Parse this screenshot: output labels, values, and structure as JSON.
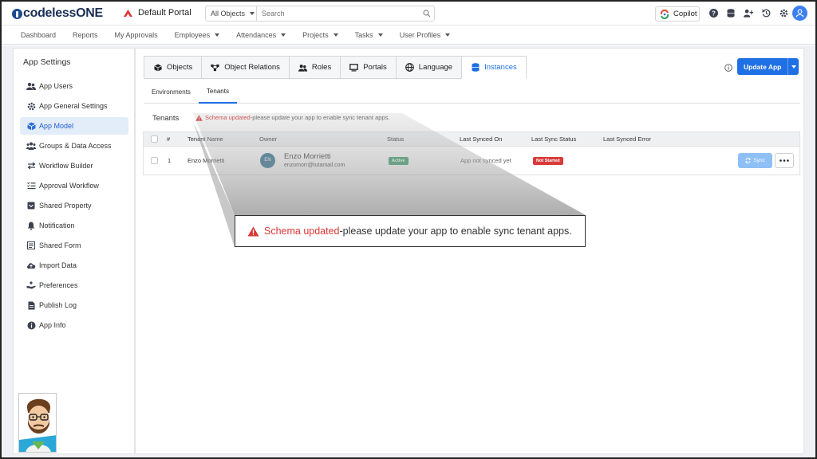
{
  "app": {
    "logo_text": "codelessONE",
    "portal": "Default Portal"
  },
  "search": {
    "scope": "All Objects",
    "placeholder": "Search"
  },
  "topbar": {
    "copilot": "Copilot"
  },
  "nav": [
    "Dashboard",
    "Reports",
    "My Approvals",
    "Employees",
    "Attendances",
    "Projects",
    "Tasks",
    "User Profiles"
  ],
  "sidebar": {
    "title": "App Settings",
    "items": [
      {
        "label": "App Users",
        "icon": "users-icon"
      },
      {
        "label": "App General Settings",
        "icon": "gear-icon"
      },
      {
        "label": "App Model",
        "icon": "cube-icon"
      },
      {
        "label": "Groups & Data Access",
        "icon": "group-icon"
      },
      {
        "label": "Workflow Builder",
        "icon": "arrows-icon"
      },
      {
        "label": "Approval Workflow",
        "icon": "checklist-icon"
      },
      {
        "label": "Shared Property",
        "icon": "shared-property-icon"
      },
      {
        "label": "Notification",
        "icon": "bell-icon"
      },
      {
        "label": "Shared Form",
        "icon": "form-icon"
      },
      {
        "label": "Import Data",
        "icon": "cloud-upload-icon"
      },
      {
        "label": "Preferences",
        "icon": "hand-icon"
      },
      {
        "label": "Publish Log",
        "icon": "log-icon"
      },
      {
        "label": "App Info",
        "icon": "info-icon"
      }
    ]
  },
  "tabs": [
    "Objects",
    "Object Relations",
    "Roles",
    "Portals",
    "Language",
    "Instances"
  ],
  "update_button": "Update App",
  "subtabs": [
    "Environments",
    "Tenants"
  ],
  "section": {
    "title": "Tenants",
    "warning_emphasis": "Schema updated",
    "warning_rest": "-please update your app to enable sync tenant apps."
  },
  "table": {
    "headers": [
      "#",
      "Tenant Name",
      "Owner",
      "Status",
      "Last Synced On",
      "Last Sync Status",
      "Last Synced Error"
    ],
    "rows": [
      {
        "num": "1",
        "tenant_name": "Enzo Morrietti",
        "owner_initials": "EN",
        "owner_name": "Enzo Morrietti",
        "owner_email": "enzomorr@tutamail.com",
        "status": "Active",
        "last_synced_on": "App not synced yet",
        "last_sync_status": "Not Started",
        "last_synced_error": "",
        "sync_label": "Sync"
      }
    ]
  },
  "colors": {
    "accent": "#1f6fe5",
    "danger": "#d93636",
    "success": "#3aa06b"
  }
}
